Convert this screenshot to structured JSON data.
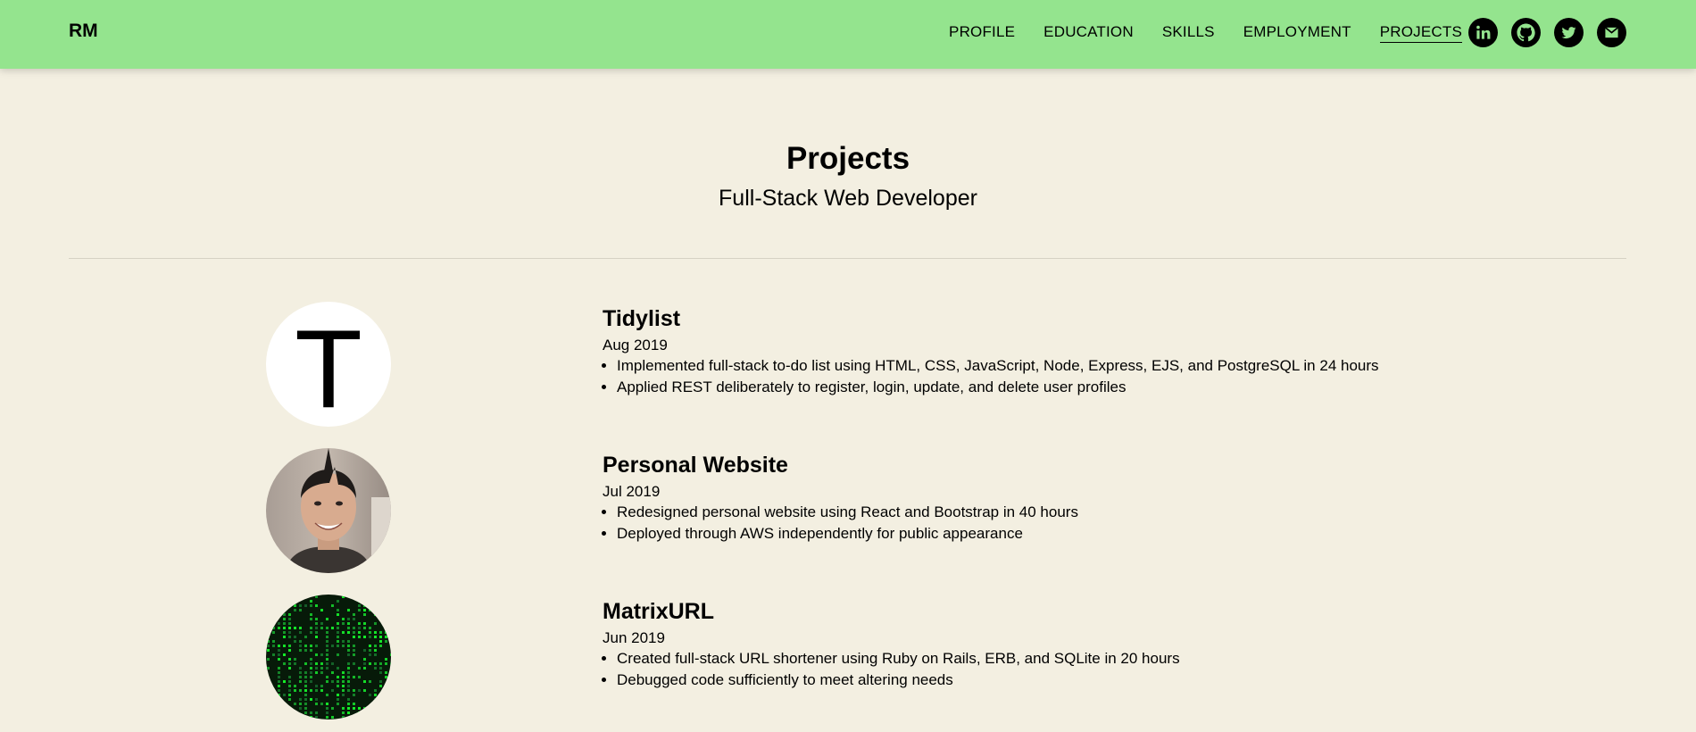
{
  "nav": {
    "brand": "RM",
    "links": [
      "PROFILE",
      "EDUCATION",
      "SKILLS",
      "EMPLOYMENT",
      "PROJECTS"
    ],
    "active": "PROJECTS",
    "social_icons": [
      "linkedin-icon",
      "github-icon",
      "twitter-icon",
      "mail-icon"
    ]
  },
  "header": {
    "title": "Projects",
    "subtitle": "Full-Stack Web Developer"
  },
  "projects": [
    {
      "title": "Tidylist",
      "date": "Aug 2019",
      "avatar_letter": "T",
      "bullets": [
        "Implemented full-stack to-do list using HTML, CSS, JavaScript, Node, Express, EJS, and PostgreSQL in 24 hours",
        "Applied REST deliberately to register, login, update, and delete user profiles"
      ]
    },
    {
      "title": "Personal Website",
      "date": "Jul 2019",
      "bullets": [
        "Redesigned personal website using React and Bootstrap in 40 hours",
        "Deployed through AWS independently for public appearance"
      ]
    },
    {
      "title": "MatrixURL",
      "date": "Jun 2019",
      "bullets": [
        "Created full-stack URL shortener using Ruby on Rails, ERB, and SQLite in 20 hours",
        "Debugged code sufficiently to meet altering needs"
      ]
    }
  ],
  "colors": {
    "navbar": "#94e48e",
    "background": "#f3efe1",
    "text": "#000000"
  }
}
